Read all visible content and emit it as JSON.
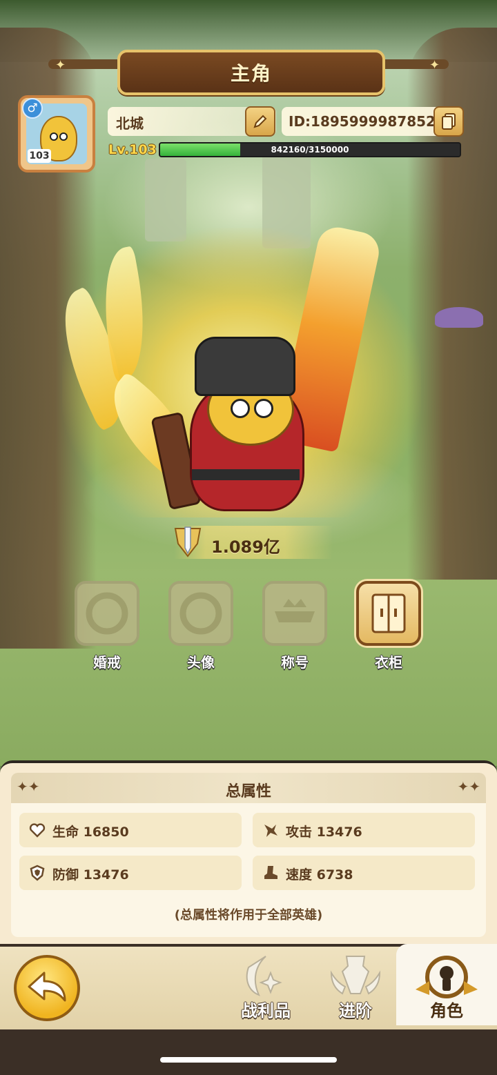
{
  "header": {
    "title": "主角"
  },
  "profile": {
    "gender_icon": "male-symbol",
    "avatar_level": "103",
    "name": "北城",
    "id_text": "ID:1895999987852",
    "level_label": "Lv.103",
    "xp_text": "842160/3150000",
    "xp_fraction": 0.2673
  },
  "power": {
    "value": "1.089亿"
  },
  "features": [
    {
      "label": "婚戒",
      "state": "locked"
    },
    {
      "label": "头像",
      "state": "locked"
    },
    {
      "label": "称号",
      "state": "locked"
    },
    {
      "label": "衣柜",
      "state": "active"
    }
  ],
  "attributes": {
    "title": "总属性",
    "stats": [
      {
        "icon": "heart-icon",
        "text": "生命 16850"
      },
      {
        "icon": "attack-icon",
        "text": "攻击 13476"
      },
      {
        "icon": "shield-icon",
        "text": "防御 13476"
      },
      {
        "icon": "speed-boot-icon",
        "text": "速度 6738"
      }
    ],
    "note": "(总属性将作用于全部英雄)"
  },
  "nav": {
    "items": [
      {
        "label": "战利品",
        "active": false
      },
      {
        "label": "进阶",
        "active": false
      },
      {
        "label": "角色",
        "active": true
      }
    ]
  },
  "colors": {
    "banner": "#5a3216",
    "gold": "#e7c36a",
    "xp_fill": "#35b23b",
    "panel": "#f7ead0"
  }
}
